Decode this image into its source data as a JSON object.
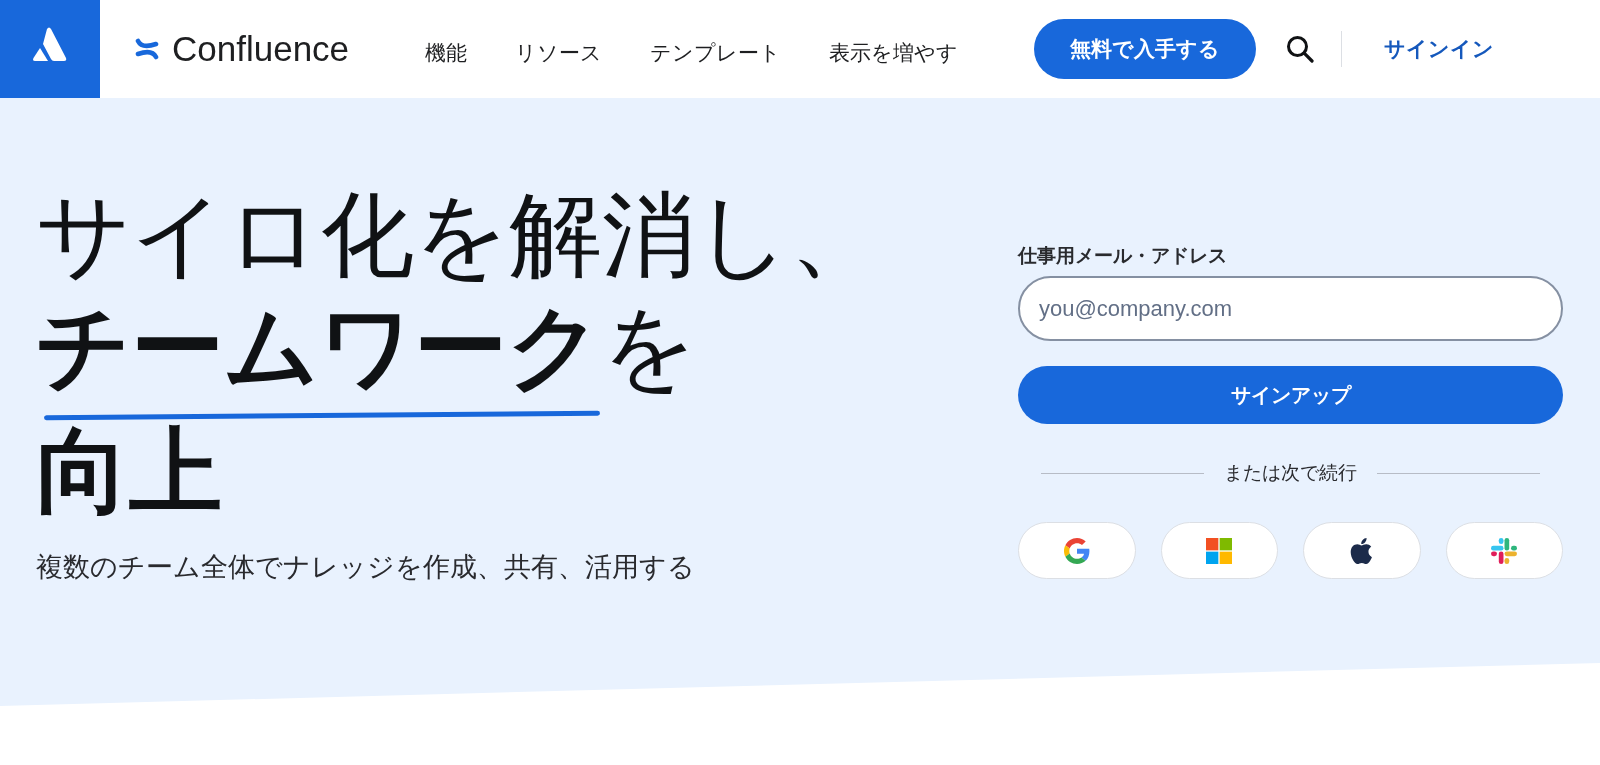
{
  "header": {
    "product_name": "Confluence",
    "nav": [
      "機能",
      "リソース",
      "テンプレート",
      "表示を増やす"
    ],
    "cta_button": "無料で入手する",
    "sign_in_link": "サインイン"
  },
  "hero": {
    "headline_lines": [
      {
        "text": "サイロ化を解消し、",
        "underlined": false
      },
      {
        "text": "**チームワーク**を",
        "underlined": true
      },
      {
        "text": "**向上**",
        "underlined": false
      }
    ],
    "subtitle": "複数のチーム全体でナレッジを作成、共有、活用する"
  },
  "signup_form": {
    "email_label": "仕事用メール・アドレス",
    "email_field": {
      "placeholder": "you@company.com"
    },
    "submit_button": "サインアップ",
    "divider_text": "または次で続行",
    "social_buttons": [
      {
        "kind": "google"
      },
      {
        "kind": "microsoft"
      },
      {
        "kind": "apple"
      },
      {
        "kind": "slack"
      }
    ]
  }
}
